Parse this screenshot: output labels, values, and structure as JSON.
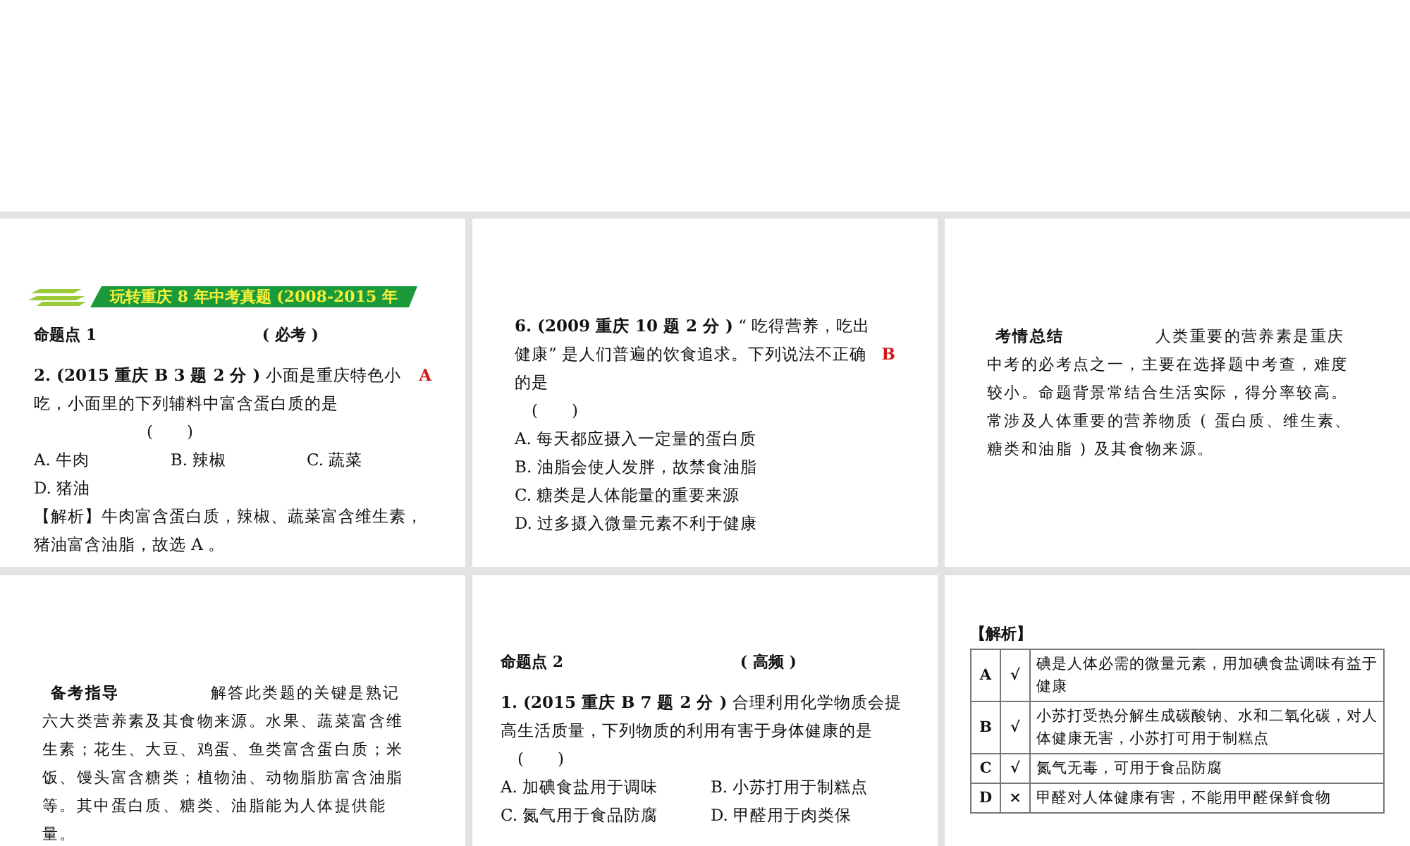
{
  "slides": [
    {
      "blocks": [
        {
          "kind": "banner",
          "text": "玩转重庆 8 年中考真题 (2008-2015 年"
        },
        {
          "kind": "heading",
          "title": "命题点 1",
          "tag": "( 必考 )"
        },
        {
          "kind": "question",
          "stem": "**2. (2015 重庆 B  3 题 2 分 )** 小面是重庆特色小吃，小面里的下列辅料中富含蛋白质的是",
          "answer": "A",
          "blank": "(　　)"
        },
        {
          "kind": "options",
          "items": [
            "A.  牛肉",
            "B.  辣椒",
            "C.  蔬菜",
            "D.  猪油"
          ]
        },
        {
          "kind": "analysis",
          "text": "【解析】牛肉富含蛋白质，辣椒、蔬菜富含维生素，猪油富含油脂，故选 A 。"
        }
      ]
    },
    {
      "blocks": [
        {
          "kind": "question",
          "stem": "**6. (2009 重庆 10 题 2 分 )** “ 吃得营养，吃出健康” 是人们普遍的饮食追求。下列说法不正确的是",
          "answer": "B",
          "blank": "(　　)"
        },
        {
          "kind": "options",
          "items": [
            "A.  每天都应摄入一定量的蛋白质",
            "B.  油脂会使人发胖，故禁食油脂",
            "C.  糖类是人体能量的重要来源",
            "D.  过多摄入微量元素不利于健康"
          ]
        }
      ]
    },
    {
      "blocks": [
        {
          "kind": "paragraph",
          "text": "**考情总结** 人类重要的营养素是重庆中考的必考点之一，主要在选择题中考查，难度较小。命题背景常结合生活实际，得分率较高。常涉及人体重要的营养物质 ( 蛋白质、维生素、糖类和油脂 ) 及其食物来源。"
        }
      ]
    },
    {
      "blocks": [
        {
          "kind": "paragraph",
          "text": "**备考指导** 解答此类题的关键是熟记六大类营养素及其食物来源。水果、蔬菜富含维生素；花生、大豆、鸡蛋、鱼类富含蛋白质；米饭、馒头富含糖类；植物油、动物脂肪富含油脂等。其中蛋白质、糖类、油脂能为人体提供能量。"
        }
      ]
    },
    {
      "blocks": [
        {
          "kind": "heading",
          "title": "命题点 2",
          "tag": "( 高频 )"
        },
        {
          "kind": "question",
          "stem": "**1. (2015 重庆 B 7 题 2 分 )** 合理利用化学物质会提高生活质量，下列物质的利用有害于身体健康的是",
          "blank": "(　　)"
        },
        {
          "kind": "options",
          "items": [
            "A.  加碘食盐用于调味",
            "B.  小苏打用于制糕点",
            "C.  氮气用于食品防腐",
            "D.  甲醛用于肉类保"
          ]
        }
      ]
    },
    {
      "blocks": [
        {
          "kind": "label",
          "text": "【解析】"
        },
        {
          "kind": "table",
          "rows": [
            [
              "A",
              "√",
              "碘是人体必需的微量元素，用加碘食盐调味有益于健康"
            ],
            [
              "B",
              "√",
              "小苏打受热分解生成碳酸钠、水和二氧化碳，对人体健康无害，小苏打可用于制糕点"
            ],
            [
              "C",
              "√",
              "氮气无毒，可用于食品防腐"
            ],
            [
              "D",
              "×",
              "甲醛对人体健康有害，不能用甲醛保鲜食物"
            ]
          ]
        }
      ]
    }
  ]
}
